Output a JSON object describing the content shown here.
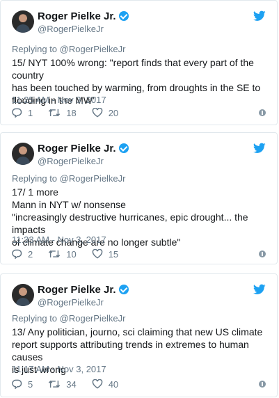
{
  "tweets": [
    {
      "name": "Roger Pielke Jr.",
      "handle": "@RogerPielkeJr",
      "replying": "Replying to @RogerPielkeJr",
      "lines": [
        "15/ NYT 100% wrong: \"report finds that every part of the country",
        "has been touched by warming, from droughts in the SE to",
        "flooding in the MW\""
      ],
      "timestamp": "11:25 AM - Nov 3, 2017",
      "replies": "1",
      "retweets": "18",
      "likes": "20"
    },
    {
      "name": "Roger Pielke Jr.",
      "handle": "@RogerPielkeJr",
      "replying": "Replying to @RogerPielkeJr",
      "lines": [
        "17/ 1 more",
        "Mann in NYT w/ nonsense",
        "\"increasingly destructive hurricanes, epic drought... the impacts",
        "of climate change are no longer subtle\""
      ],
      "timestamp": "11:33 AM - Nov 3, 2017",
      "replies": "2",
      "retweets": "10",
      "likes": "15"
    },
    {
      "name": "Roger Pielke Jr.",
      "handle": "@RogerPielkeJr",
      "replying": "Replying to @RogerPielkeJr",
      "lines": [
        "13/ Any politician, journo, sci claiming that new US climate",
        "report supports attributing trends in extremes to human causes",
        "is just wrong"
      ],
      "timestamp": "11:17 AM - Nov 3, 2017",
      "replies": "5",
      "retweets": "34",
      "likes": "40"
    }
  ],
  "icons": {
    "verified": "verified-badge-icon",
    "logo": "twitter-bird-icon",
    "reply": "reply-icon",
    "retweet": "retweet-icon",
    "like": "heart-icon",
    "info": "info-icon"
  },
  "colors": {
    "verified": "#1da1f2",
    "twitter_blue": "#1da1f2",
    "muted": "#657786",
    "border": "#e1e8ed"
  }
}
